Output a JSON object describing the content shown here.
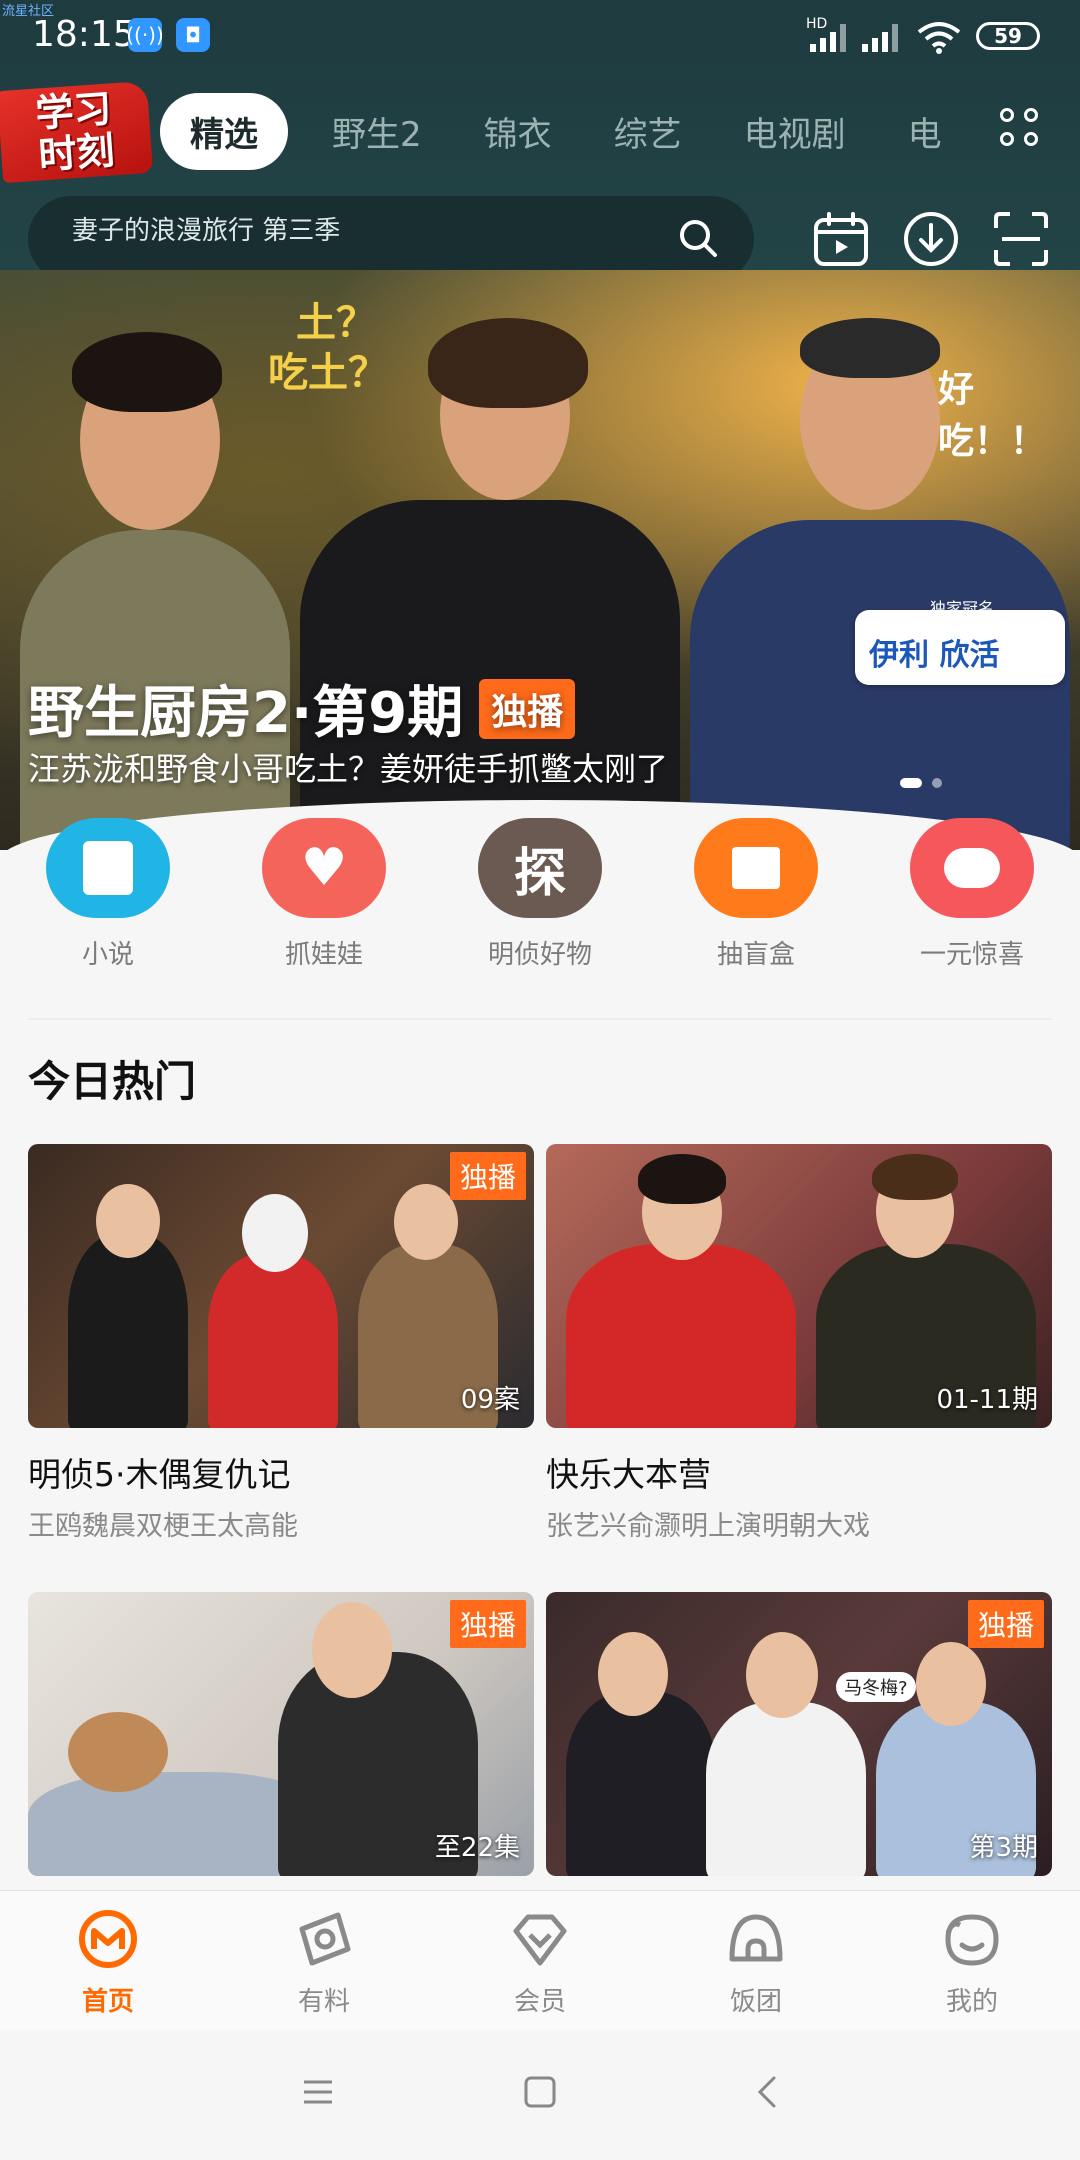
{
  "status_bar": {
    "watermark": "流星社区",
    "time": "18:15",
    "network": "HD",
    "battery": "59"
  },
  "header": {
    "logo_line1": "学习",
    "logo_line2": "时刻",
    "tabs": [
      "精选",
      "野生2",
      "锦衣",
      "综艺",
      "电视剧",
      "电"
    ],
    "active_tab": 0,
    "search_placeholder": "妻子的浪漫旅行 第三季",
    "accent": "#ff6a00"
  },
  "banner": {
    "title": "野生厨房2·第9期",
    "badge": "独播",
    "subtitle": "汪苏泷和野食小哥吃土？姜妍徒手抓鳖太刚了",
    "bubble_left": "吃土？",
    "bubble_left2": "土？",
    "bubble_right": "好吃！！",
    "sponsor_tag": "独家冠名",
    "sponsor_brand": "伊利 欣活"
  },
  "quick_entries": [
    {
      "label": "小说",
      "icon": "book-icon",
      "color": "#21b5e6",
      "glyph": "▭"
    },
    {
      "label": "抓娃娃",
      "icon": "claw-machine-icon",
      "color": "#f5645b",
      "glyph": "♥"
    },
    {
      "label": "明侦好物",
      "icon": "detective-shop-icon",
      "color": "#6b5a52",
      "glyph": "探"
    },
    {
      "label": "抽盲盒",
      "icon": "blind-box-icon",
      "color": "#ff7a1a",
      "glyph": "▣"
    },
    {
      "label": "一元惊喜",
      "icon": "bunny-icon",
      "color": "#f5575b",
      "glyph": "◕"
    }
  ],
  "section": {
    "title": "今日热门",
    "cards": [
      {
        "title": "明侦5·木偶复仇记",
        "subtitle": "王鸥魏晨双梗王太高能",
        "tag": "独播",
        "episode": "09案"
      },
      {
        "title": "快乐大本营",
        "subtitle": "张艺兴俞灏明上演明朝大戏",
        "tag": "",
        "episode": "01-11期"
      },
      {
        "title": "",
        "subtitle": "",
        "tag": "独播",
        "episode": "至22集"
      },
      {
        "title": "",
        "subtitle": "",
        "tag": "独播",
        "episode": "第3期",
        "bubble": "马冬梅?"
      }
    ]
  },
  "bottom_nav": {
    "items": [
      "首页",
      "有料",
      "会员",
      "饭团",
      "我的"
    ],
    "active": 0
  }
}
